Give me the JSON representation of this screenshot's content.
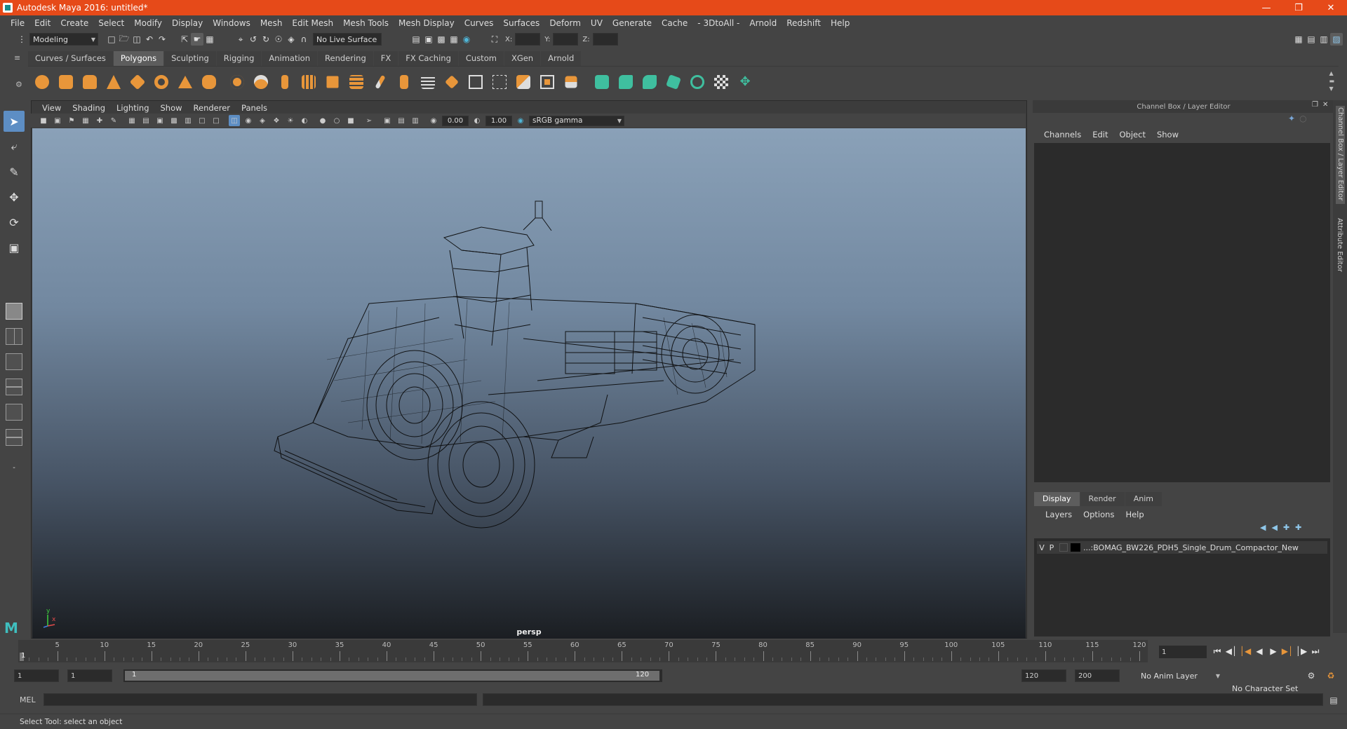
{
  "window": {
    "title": "Autodesk Maya 2016: untitled*"
  },
  "menubar": [
    "File",
    "Edit",
    "Create",
    "Select",
    "Modify",
    "Display",
    "Windows",
    "Mesh",
    "Edit Mesh",
    "Mesh Tools",
    "Mesh Display",
    "Curves",
    "Surfaces",
    "Deform",
    "UV",
    "Generate",
    "Cache",
    "- 3DtoAll -",
    "Arnold",
    "Redshift",
    "Help"
  ],
  "statusline": {
    "mode": "Modeling",
    "live_surface": "No Live Surface",
    "coord_x_label": "X:",
    "coord_y_label": "Y:",
    "coord_z_label": "Z:"
  },
  "shelf": {
    "tabs": [
      "Curves / Surfaces",
      "Polygons",
      "Sculpting",
      "Rigging",
      "Animation",
      "Rendering",
      "FX",
      "FX Caching",
      "Custom",
      "XGen",
      "Arnold"
    ],
    "active_tab": "Polygons",
    "icon_colors": {
      "primary": "#e8963a",
      "secondary": "#3fbf9f"
    }
  },
  "viewport": {
    "menu": [
      "View",
      "Shading",
      "Lighting",
      "Show",
      "Renderer",
      "Panels"
    ],
    "exposure": "0.00",
    "gamma": "1.00",
    "color_space": "sRGB gamma",
    "camera": "persp",
    "axis_y": "y",
    "axis_x": "x"
  },
  "channel_box": {
    "header": "Channel Box / Layer Editor",
    "menu": [
      "Channels",
      "Edit",
      "Object",
      "Show"
    ]
  },
  "layer_editor": {
    "tabs": [
      "Display",
      "Render",
      "Anim"
    ],
    "active_tab": "Display",
    "menu": [
      "Layers",
      "Options",
      "Help"
    ],
    "layers": [
      {
        "v": "V",
        "p": "P",
        "name": "...:BOMAG_BW226_PDH5_Single_Drum_Compactor_New"
      }
    ]
  },
  "side_tabs": [
    "Channel Box / Layer Editor",
    "Attribute Editor"
  ],
  "timeline": {
    "ticks": [
      5,
      10,
      15,
      20,
      25,
      30,
      35,
      40,
      45,
      50,
      55,
      60,
      65,
      70,
      75,
      80,
      85,
      90,
      95,
      100,
      105,
      110,
      115,
      120
    ],
    "start": 1,
    "end": 120,
    "current_frame": "1"
  },
  "range": {
    "start": "1",
    "playback_start": "1",
    "slider_start": "1",
    "slider_end": "120",
    "playback_end": "120",
    "end": "200",
    "anim_layer": "No Anim Layer",
    "character_set": "No Character Set"
  },
  "command_line": {
    "label": "MEL"
  },
  "help_line": "Select Tool: select an object"
}
